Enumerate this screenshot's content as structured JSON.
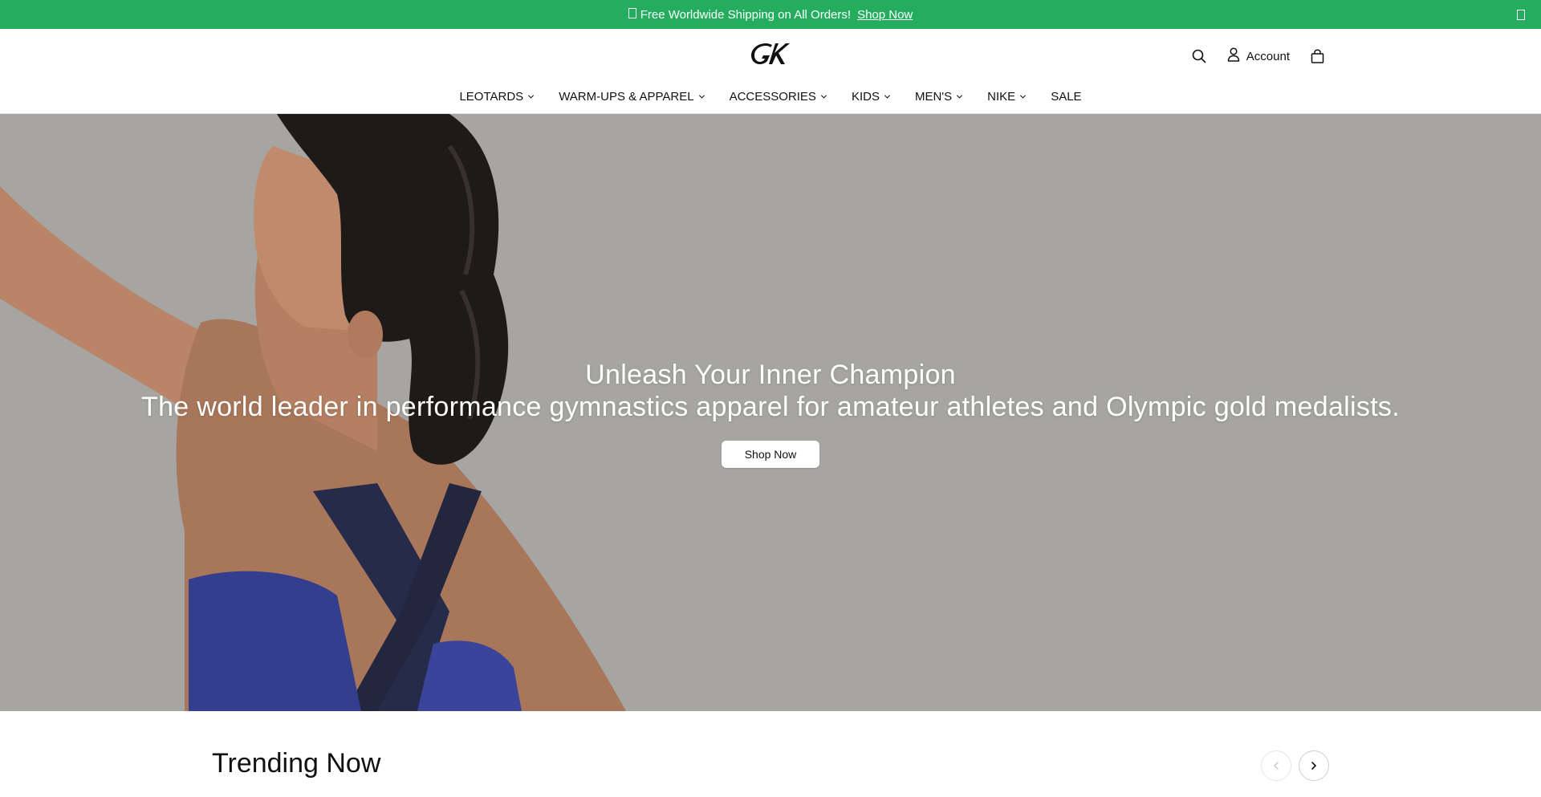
{
  "announcement": {
    "gift_icon": "gift-icon",
    "message": "Free Worldwide Shipping on All Orders!",
    "link": "Shop Now",
    "close_icon": "close-icon",
    "background_color": "#25ad5f"
  },
  "header": {
    "logo_icon": "gk-logo-icon",
    "search_icon": "search-icon",
    "account_label": "Account",
    "account_icon": "user-icon",
    "cart_icon": "shopping-bag-icon"
  },
  "nav": {
    "items": [
      {
        "label": "LEOTARDS",
        "has_dropdown": true
      },
      {
        "label": "WARM-UPS & APPAREL",
        "has_dropdown": true
      },
      {
        "label": "ACCESSORIES",
        "has_dropdown": true
      },
      {
        "label": "KIDS",
        "has_dropdown": true
      },
      {
        "label": "MEN'S",
        "has_dropdown": true
      },
      {
        "label": "NIKE",
        "has_dropdown": true
      },
      {
        "label": "SALE",
        "has_dropdown": false
      }
    ]
  },
  "hero": {
    "title": "Unleash Your Inner Champion",
    "subtitle": "The world leader in performance gymnastics apparel for amateur athletes and Olympic gold medalists.",
    "button": "Shop Now"
  },
  "trending": {
    "title": "Trending Now",
    "prev_icon": "chevron-left-icon",
    "next_icon": "chevron-right-icon"
  }
}
